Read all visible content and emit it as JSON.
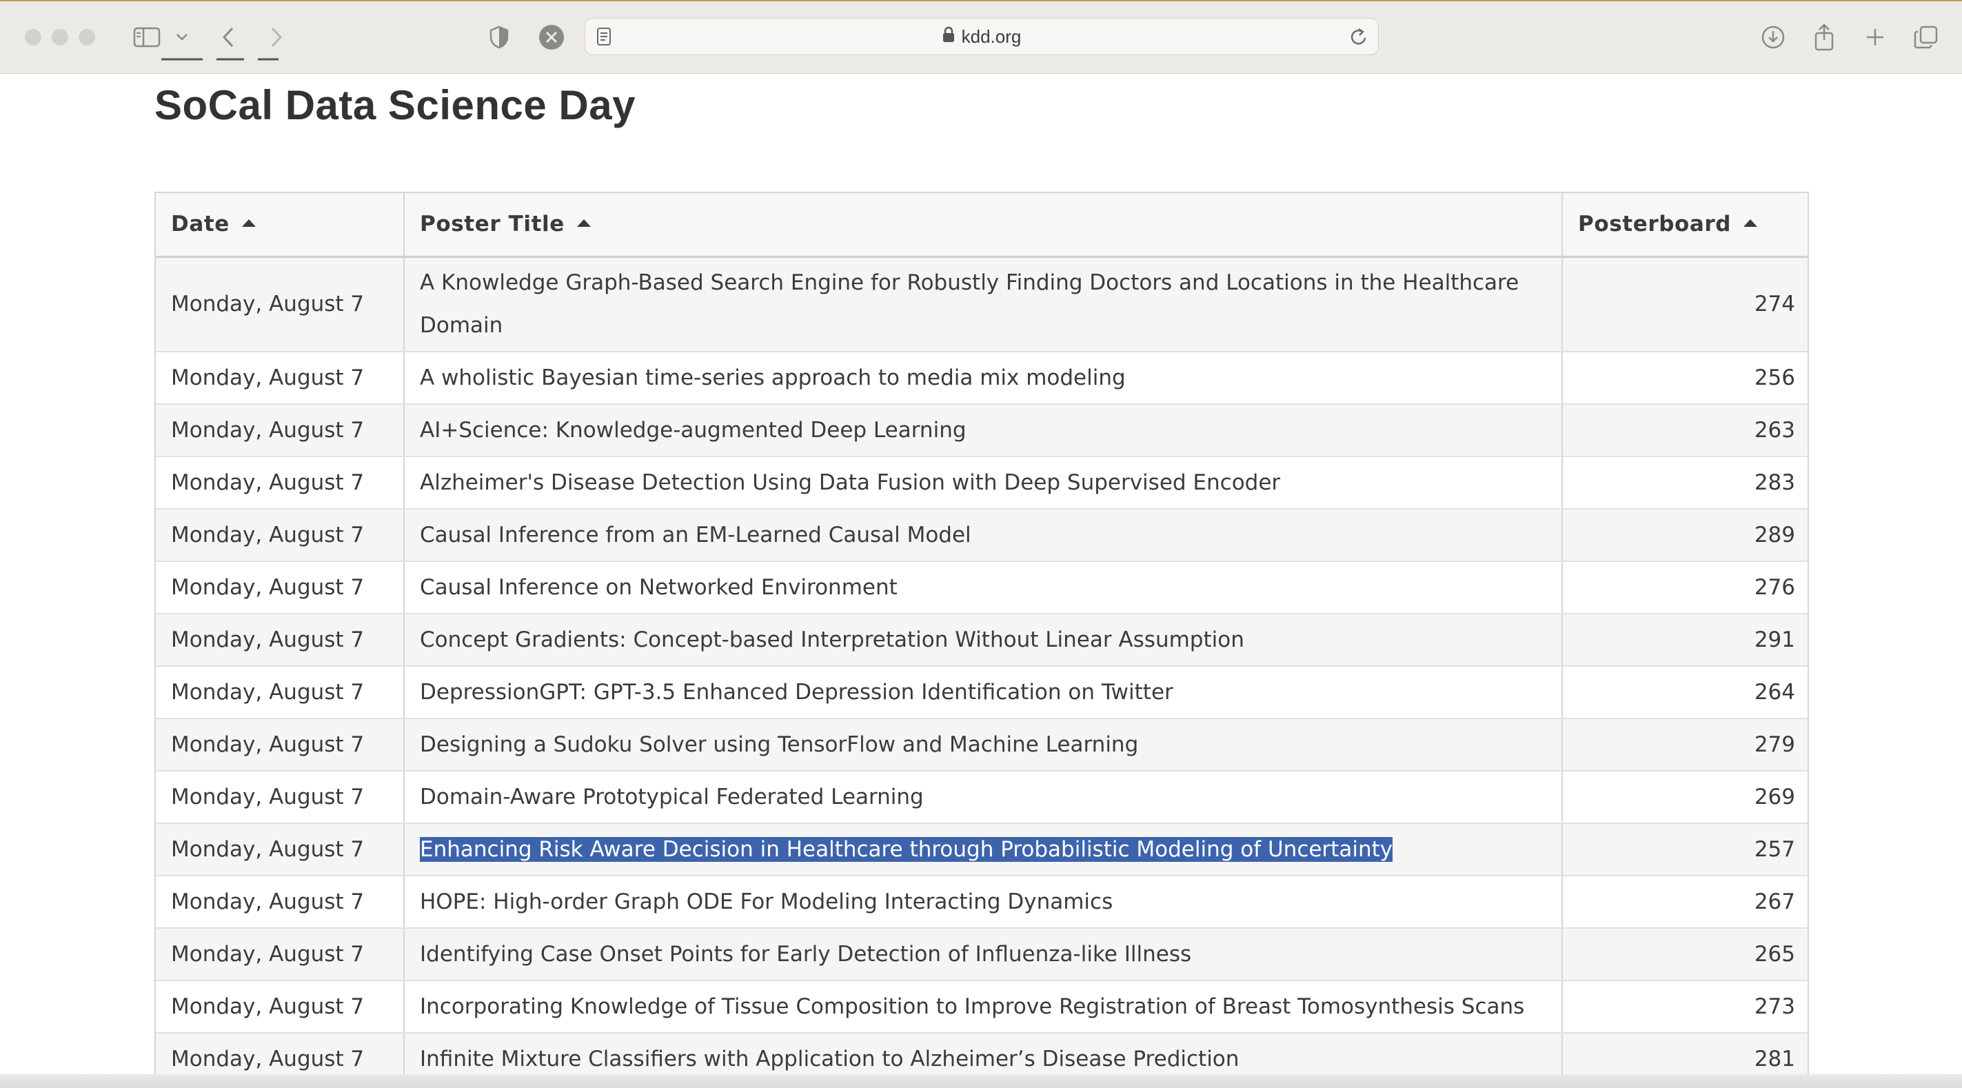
{
  "browser": {
    "url": "kdd.org",
    "icons": [
      "sidebar-icon",
      "chevron-down-icon",
      "back-icon",
      "forward-icon",
      "shield-icon",
      "close-circle-icon",
      "reader-icon",
      "lock-icon",
      "reload-icon",
      "download-icon",
      "share-icon",
      "new-tab-icon",
      "tabs-overview-icon"
    ]
  },
  "page": {
    "title": "SoCal Data Science Day"
  },
  "table": {
    "headers": {
      "date": "Date",
      "title": "Poster Title",
      "board": "Posterboard"
    },
    "rows": [
      {
        "date": "Monday, August 7",
        "title": "A Knowledge Graph-Based Search Engine for Robustly Finding Doctors and Locations in the Healthcare Domain",
        "board": "274"
      },
      {
        "date": "Monday, August 7",
        "title": "A wholistic Bayesian time-series approach to media mix modeling",
        "board": "256"
      },
      {
        "date": "Monday, August 7",
        "title": "AI+Science: Knowledge-augmented Deep Learning",
        "board": "263"
      },
      {
        "date": "Monday, August 7",
        "title": "Alzheimer's Disease Detection Using Data Fusion with Deep Supervised Encoder",
        "board": "283"
      },
      {
        "date": "Monday, August 7",
        "title": "Causal Inference from an EM-Learned Causal Model",
        "board": "289"
      },
      {
        "date": "Monday, August 7",
        "title": "Causal Inference on Networked Environment",
        "board": "276"
      },
      {
        "date": "Monday, August 7",
        "title": "Concept Gradients: Concept-based Interpretation Without Linear Assumption",
        "board": "291"
      },
      {
        "date": "Monday, August 7",
        "title": "DepressionGPT: GPT-3.5 Enhanced Depression Identification on Twitter",
        "board": "264"
      },
      {
        "date": "Monday, August 7",
        "title": "Designing a Sudoku Solver using TensorFlow and Machine Learning",
        "board": "279"
      },
      {
        "date": "Monday, August 7",
        "title": "Domain-Aware Prototypical Federated Learning",
        "board": "269"
      },
      {
        "date": "Monday, August 7",
        "title": "Enhancing Risk Aware Decision in Healthcare through Probabilistic Modeling of Uncertainty",
        "board": "257"
      },
      {
        "date": "Monday, August 7",
        "title": "HOPE: High-order Graph ODE For Modeling Interacting Dynamics",
        "board": "267"
      },
      {
        "date": "Monday, August 7",
        "title": "Identifying Case Onset Points for Early Detection of Influenza-like Illness",
        "board": "265"
      },
      {
        "date": "Monday, August 7",
        "title": "Incorporating Knowledge of Tissue Composition to Improve Registration of Breast Tomosynthesis Scans",
        "board": "273"
      },
      {
        "date": "Monday, August 7",
        "title": "Infinite Mixture Classifiers with Application to Alzheimer’s Disease Prediction",
        "board": "281"
      }
    ]
  },
  "colors": {
    "selection": "#3d63ad",
    "title_text": "#333333",
    "row_stripe": "#f5f5f5"
  }
}
